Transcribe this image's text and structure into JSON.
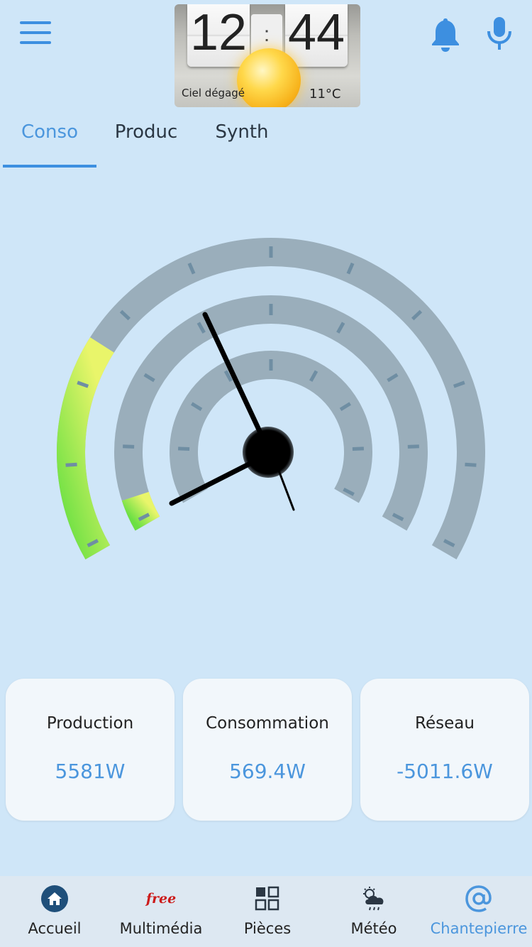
{
  "header": {
    "menu_icon": "hamburger-menu-icon",
    "notification_icon": "bell-icon",
    "voice_icon": "microphone-icon"
  },
  "weather_widget": {
    "hours": "12",
    "minutes": "44",
    "separator": ":",
    "condition": "Ciel dégagé",
    "temperature": "11°C",
    "icon": "sun-icon"
  },
  "tabs": [
    {
      "label": "Conso",
      "active": true
    },
    {
      "label": "Produc",
      "active": false
    },
    {
      "label": "Synth",
      "active": false
    }
  ],
  "gauge": {
    "type": "multi-ring dial",
    "rings": 3,
    "outer_ring_fill_fraction": 0.26,
    "middle_ring_fill_fraction": 0.05,
    "inner_ring_fill_fraction": 0,
    "colors": {
      "track": "#9aaebb",
      "fill_low": "#6be043",
      "fill_high": "#e9f56a",
      "needle": "#000000",
      "tick": "#6f8ea3"
    }
  },
  "cards": [
    {
      "label": "Production",
      "value": "5581W"
    },
    {
      "label": "Consommation",
      "value": "569.4W"
    },
    {
      "label": "Réseau",
      "value": "-5011.6W"
    }
  ],
  "bottom_nav": [
    {
      "label": "Accueil",
      "icon": "home-icon",
      "active": false
    },
    {
      "label": "Multimédia",
      "icon": "free-logo-icon",
      "icon_text": "free",
      "active": false
    },
    {
      "label": "Pièces",
      "icon": "rooms-grid-icon",
      "active": false
    },
    {
      "label": "Météo",
      "icon": "weather-cloud-icon",
      "active": false
    },
    {
      "label": "Chantepierre",
      "icon": "at-sign-icon",
      "active": true
    }
  ],
  "accent_color": "#4b96dd"
}
